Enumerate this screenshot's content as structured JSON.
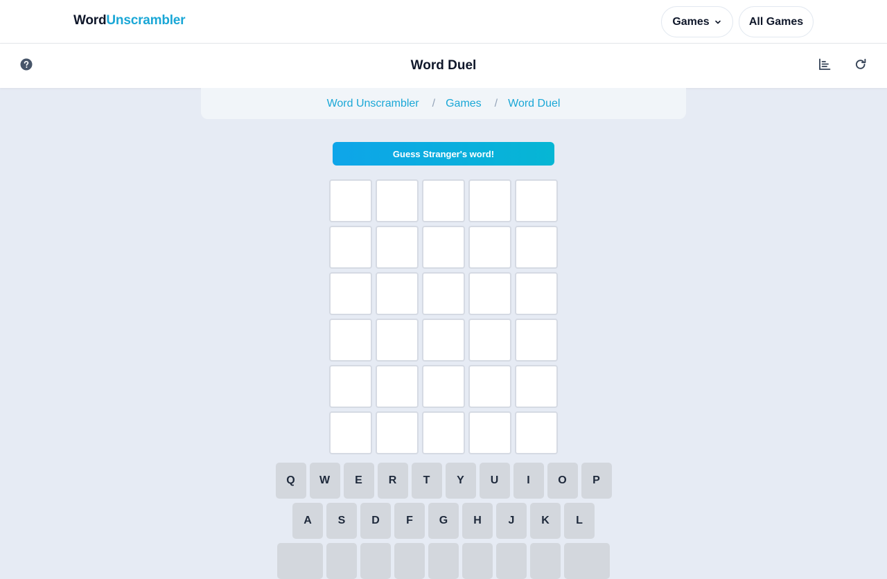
{
  "header": {
    "logo_part1": "Word",
    "logo_part2": "Unscrambler",
    "games_label": "Games",
    "all_games_label": "All Games",
    "accent_color": "#1aa7d6"
  },
  "game_bar": {
    "title": "Word Duel",
    "help_icon": "question-circle-icon",
    "stats_icon": "bar-chart-icon",
    "restart_icon": "refresh-icon"
  },
  "breadcrumb": {
    "items": [
      "Word Unscrambler",
      "Games",
      "Word Duel"
    ],
    "separator": "/"
  },
  "banner": {
    "text": "Guess Stranger's word!"
  },
  "board": {
    "rows": 6,
    "cols": 5,
    "letters": [
      [
        "",
        "",
        "",
        "",
        ""
      ],
      [
        "",
        "",
        "",
        "",
        ""
      ],
      [
        "",
        "",
        "",
        "",
        ""
      ],
      [
        "",
        "",
        "",
        "",
        ""
      ],
      [
        "",
        "",
        "",
        "",
        ""
      ],
      [
        "",
        "",
        "",
        "",
        ""
      ]
    ]
  },
  "keyboard": {
    "row1": [
      "Q",
      "W",
      "E",
      "R",
      "T",
      "Y",
      "U",
      "I",
      "O",
      "P"
    ],
    "row2": [
      "A",
      "S",
      "D",
      "F",
      "G",
      "H",
      "J",
      "K",
      "L"
    ],
    "row3": [
      "",
      "",
      "",
      "",
      "",
      "",
      "",
      "",
      ""
    ]
  }
}
